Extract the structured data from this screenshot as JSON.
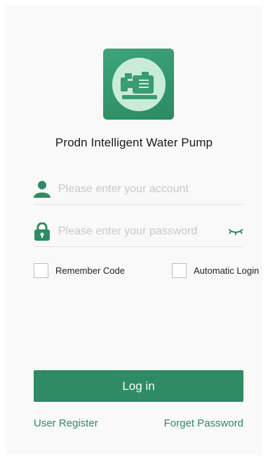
{
  "app": {
    "title": "Prodn Intelligent Water Pump",
    "logo_icon": "water-pump-icon"
  },
  "login_form": {
    "account": {
      "icon": "user-icon",
      "placeholder": "Please enter your account",
      "value": ""
    },
    "password": {
      "icon": "lock-icon",
      "placeholder": "Please enter your password",
      "value": "",
      "toggle_icon": "eye-closed-icon"
    },
    "remember_code": {
      "label": "Remember Code",
      "checked": false
    },
    "automatic_login": {
      "label": "Automatic Login",
      "checked": false
    },
    "login_button": "Log in",
    "user_register": "User Register",
    "forget_password": "Forget Password"
  },
  "colors": {
    "accent": "#2e8b63",
    "logo_background": "#3ea57a",
    "placeholder": "#c9c9c9"
  }
}
